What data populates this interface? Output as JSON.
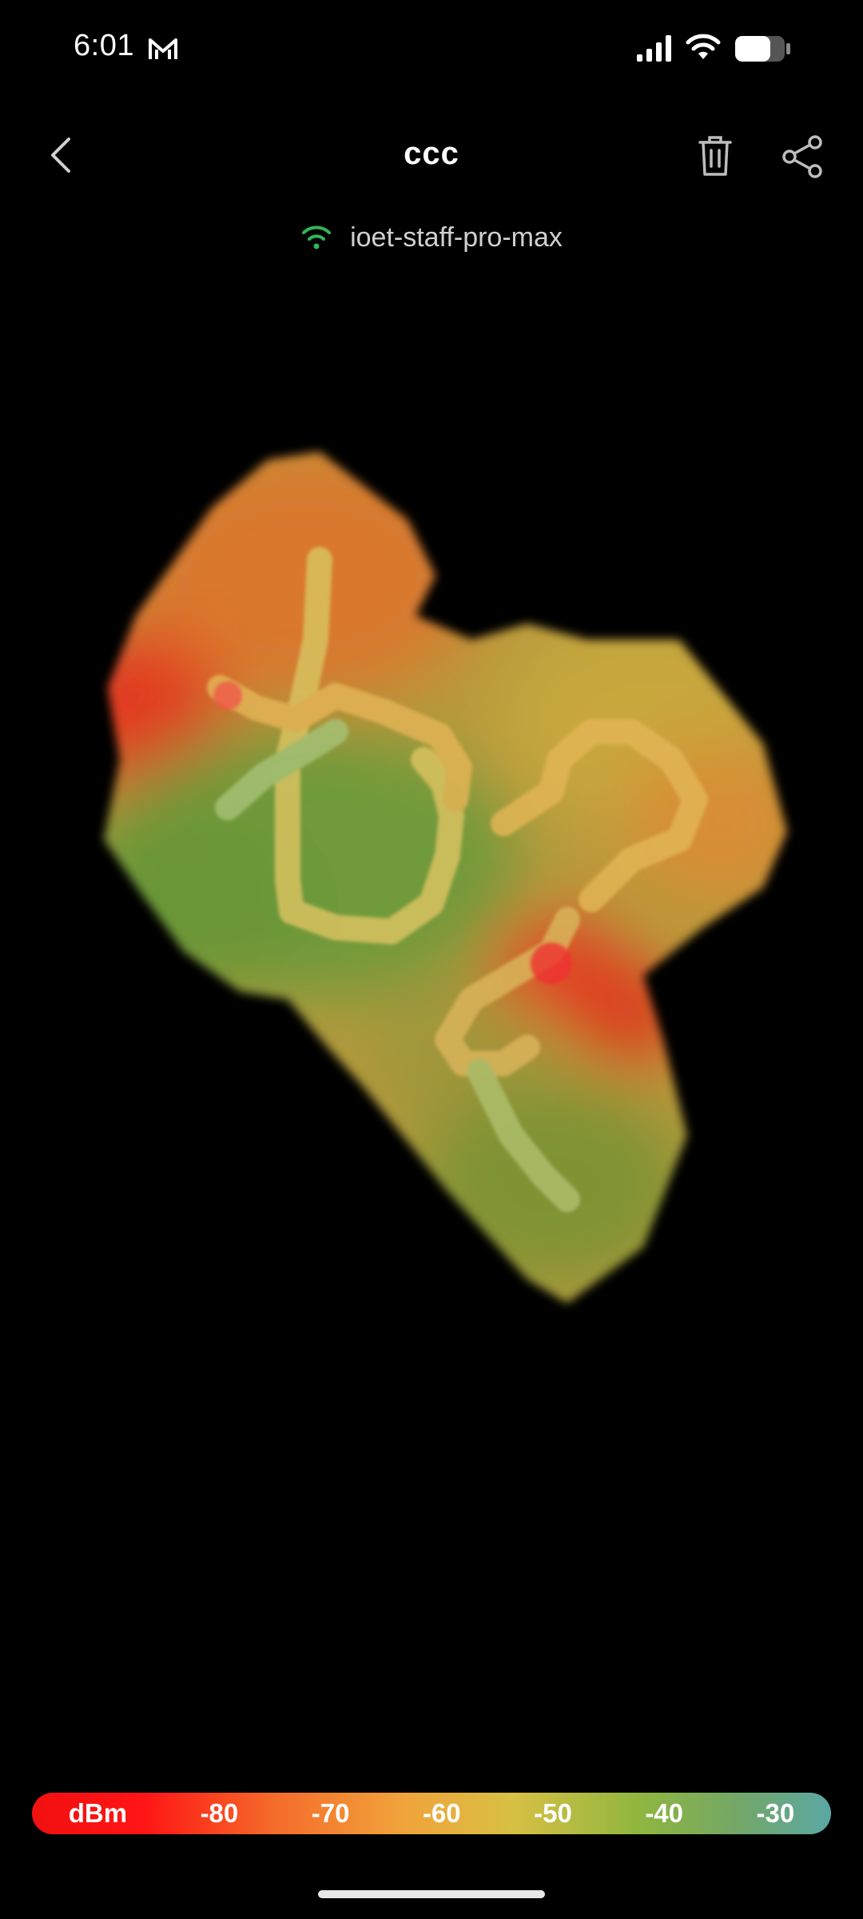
{
  "status_bar": {
    "time": "6:01",
    "icons": [
      "mail-icon",
      "signal-icon",
      "wifi-icon",
      "battery-icon"
    ]
  },
  "header": {
    "title": "ccc",
    "back_icon": "chevron-left-icon",
    "delete_icon": "trash-icon",
    "share_icon": "share-icon"
  },
  "network": {
    "icon": "wifi-icon",
    "ssid": "ioet-staff-pro-max",
    "icon_color": "#2fb75b"
  },
  "legend": {
    "labels": [
      "dBm",
      "-80",
      "-70",
      "-60",
      "-50",
      "-40",
      "-30"
    ],
    "colors": [
      "#f21010",
      "#f56a2a",
      "#f1a23b",
      "#d8c044",
      "#8fb63f",
      "#5aa7a4"
    ]
  }
}
